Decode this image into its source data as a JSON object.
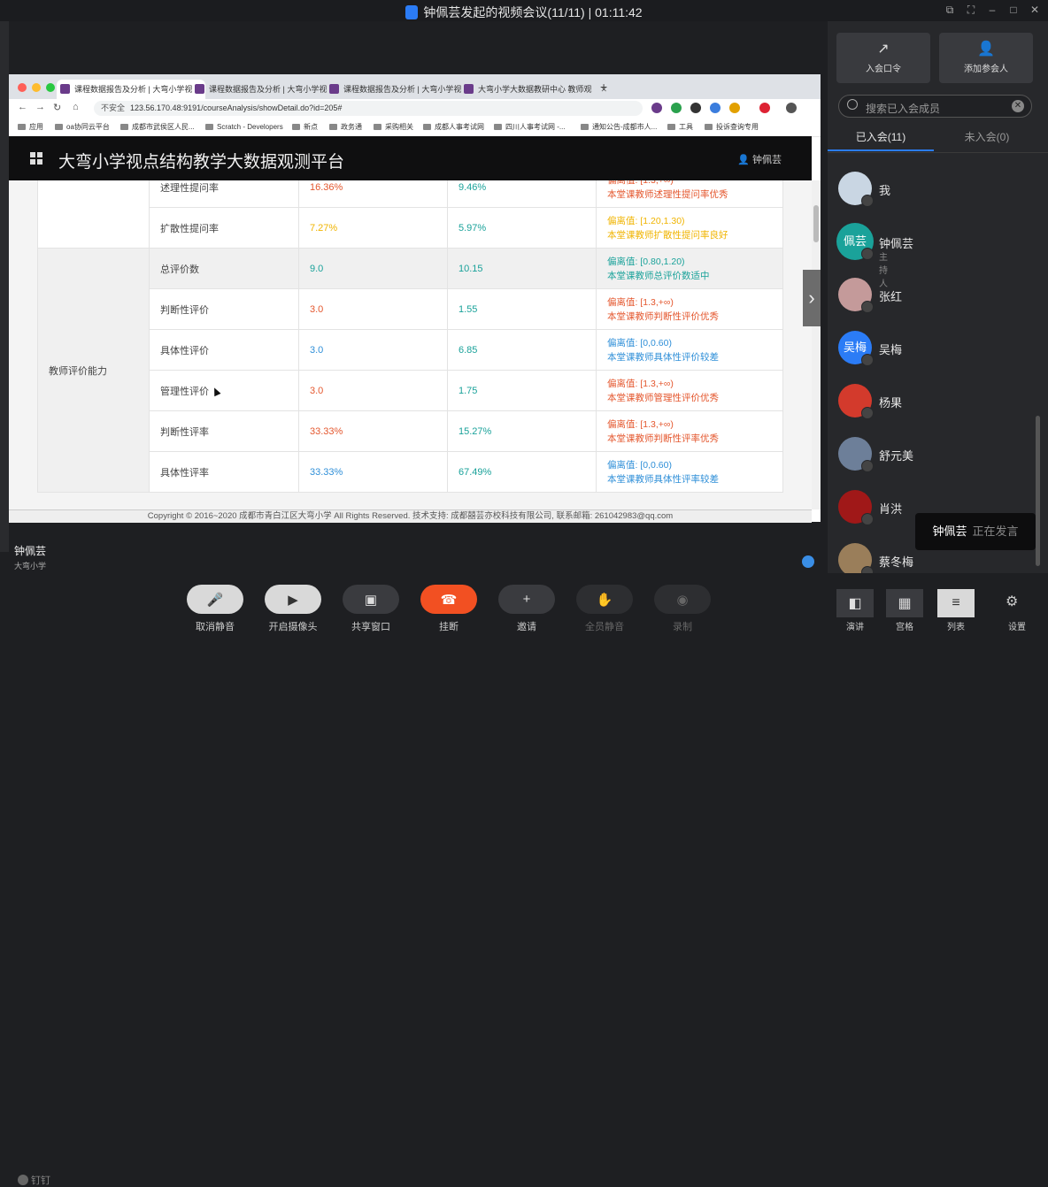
{
  "window": {
    "title": "钟佩芸发起的视频会议(11/11) | 01:11:42"
  },
  "browser": {
    "tabs": [
      {
        "label": "课程数据报告及分析 | 大弯小学视",
        "active": true
      },
      {
        "label": "课程数据报告及分析 | 大弯小学视",
        "active": false
      },
      {
        "label": "课程数据报告及分析 | 大弯小学视",
        "active": false
      },
      {
        "label": "大弯小学大数据教研中心 教师观",
        "active": false
      }
    ],
    "not_secure": "不安全",
    "url": "123.56.170.48:9191/courseAnalysis/showDetail.do?id=205#",
    "bookmarks": [
      "应用",
      "oa协同云平台",
      "成都市武侯区人民...",
      "Scratch - Developers",
      "新点",
      "政务通",
      "采购相关",
      "成都人事考试网",
      "四川人事考试网 -...",
      "通知公告-成都市人...",
      "工具",
      "投诉查询专用"
    ]
  },
  "app": {
    "title": "大弯小学视点结构教学大数据观测平台",
    "user": "钟佩芸",
    "category": "教师评价能力",
    "rows": [
      {
        "name": "述理性提问率",
        "v1": "16.36%",
        "v1c": "orange",
        "v2": "9.46%",
        "v2c": "teal",
        "note1": "偏离值: [1.3,+∞)",
        "note2": "本堂课教师述理性提问率优秀",
        "nc": "orange"
      },
      {
        "name": "扩散性提问率",
        "v1": "7.27%",
        "v1c": "yellow",
        "v2": "5.97%",
        "v2c": "teal",
        "note1": "偏离值: [1.20,1.30)",
        "note2": "本堂课教师扩散性提问率良好",
        "nc": "yellow"
      },
      {
        "name": "总评价数",
        "v1": "9.0",
        "v1c": "teal",
        "v2": "10.15",
        "v2c": "teal",
        "note1": "偏离值: [0.80,1.20)",
        "note2": "本堂课教师总评价数适中",
        "nc": "teal"
      },
      {
        "name": "判断性评价",
        "v1": "3.0",
        "v1c": "orange",
        "v2": "1.55",
        "v2c": "teal",
        "note1": "偏离值: [1.3,+∞)",
        "note2": "本堂课教师判断性评价优秀",
        "nc": "orange"
      },
      {
        "name": "具体性评价",
        "v1": "3.0",
        "v1c": "blue",
        "v2": "6.85",
        "v2c": "teal",
        "note1": "偏离值: [0,0.60)",
        "note2": "本堂课教师具体性评价较差",
        "nc": "blue"
      },
      {
        "name": "管理性评价",
        "v1": "3.0",
        "v1c": "orange",
        "v2": "1.75",
        "v2c": "teal",
        "note1": "偏离值: [1.3,+∞)",
        "note2": "本堂课教师管理性评价优秀",
        "nc": "orange"
      },
      {
        "name": "判断性评率",
        "v1": "33.33%",
        "v1c": "orange",
        "v2": "15.27%",
        "v2c": "teal",
        "note1": "偏离值: [1.3,+∞)",
        "note2": "本堂课教师判断性评率优秀",
        "nc": "orange"
      },
      {
        "name": "具体性评率",
        "v1": "33.33%",
        "v1c": "blue",
        "v2": "67.49%",
        "v2c": "teal",
        "note1": "偏离值: [0,0.60)",
        "note2": "本堂课教师具体性评率较差",
        "nc": "blue"
      }
    ],
    "footer": "Copyright © 2016~2020 成都市青白江区大弯小学 All Rights Reserved. 技术支持: 成都囍芸亦校科技有限公司, 联系邮箱: 261042983@qq.com"
  },
  "speaker": {
    "name": "钟佩芸",
    "org": "大弯小学"
  },
  "brand": "钉钉",
  "controls": [
    {
      "label": "取消静音",
      "icon": "mic-icon"
    },
    {
      "label": "开启摄像头",
      "icon": "camera-off-icon"
    },
    {
      "label": "共享窗口",
      "icon": "share-screen-icon"
    },
    {
      "label": "挂断",
      "icon": "hangup-icon"
    },
    {
      "label": "邀请",
      "icon": "invite-icon"
    },
    {
      "label": "全员静音",
      "icon": "mute-all-icon"
    },
    {
      "label": "录制",
      "icon": "record-icon"
    }
  ],
  "panel": {
    "join_code": "入会口令",
    "add_member": "添加参会人",
    "search_placeholder": "搜索已入会成员",
    "tab_joined": "已入会(11)",
    "tab_not_joined": "未入会(0)",
    "members": [
      {
        "name": "我",
        "role": "",
        "avatar_text": ""
      },
      {
        "name": "钟佩芸",
        "role": "主持人",
        "avatar_text": "佩芸"
      },
      {
        "name": "张红",
        "role": "",
        "avatar_text": ""
      },
      {
        "name": "吴梅",
        "role": "",
        "avatar_text": "吴梅"
      },
      {
        "name": "杨果",
        "role": "",
        "avatar_text": ""
      },
      {
        "name": "舒元美",
        "role": "",
        "avatar_text": ""
      },
      {
        "name": "肖洪",
        "role": "",
        "avatar_text": ""
      },
      {
        "name": "蔡冬梅",
        "role": "",
        "avatar_text": ""
      }
    ],
    "speaking_name": "钟佩芸",
    "speaking_status": "正在发言"
  },
  "view": {
    "speech": "演讲",
    "grid": "宫格",
    "list": "列表",
    "settings": "设置"
  },
  "colors": {
    "accent": "#2b7cf6",
    "hangup": "#f25022",
    "orange": "#e4572e",
    "yellow": "#f0b400",
    "teal": "#1aa29a",
    "blue": "#2f8fd8"
  }
}
